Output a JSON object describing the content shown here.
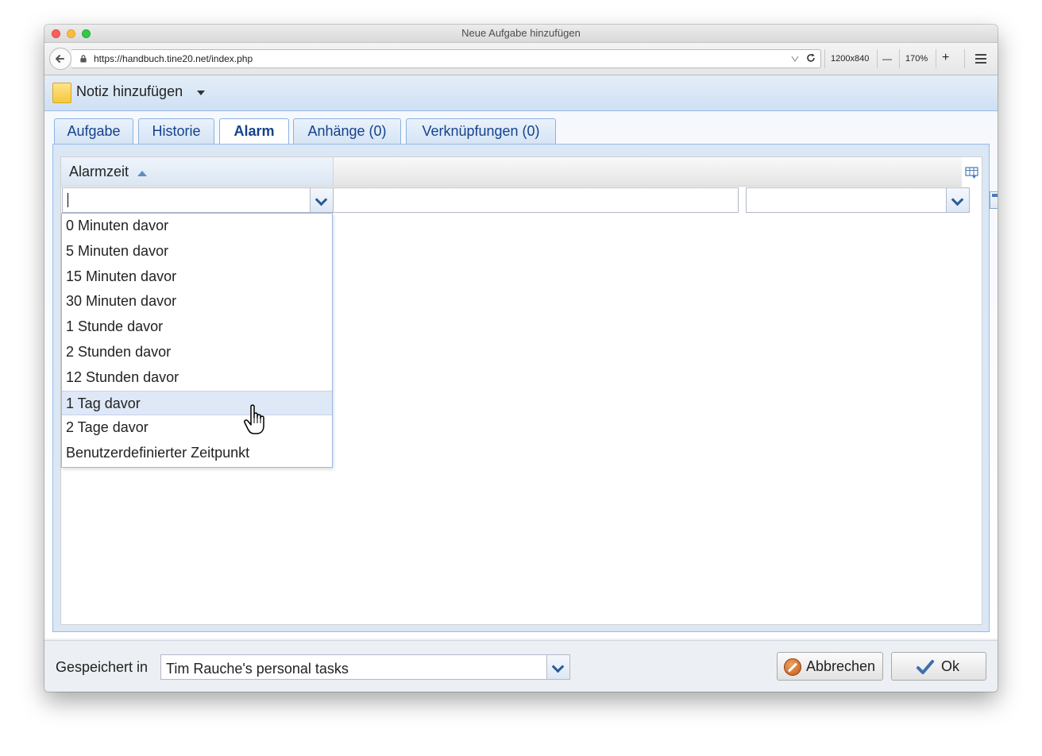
{
  "window": {
    "title": "Neue Aufgabe hinzufügen"
  },
  "browser": {
    "url": "https://handbuch.tine20.net/index.php",
    "viewport": "1200x840",
    "zoom_minus": "—",
    "zoom": "170%",
    "zoom_plus": "+"
  },
  "app": {
    "title": "Notiz hinzufügen"
  },
  "tabs": [
    {
      "label": "Aufgabe"
    },
    {
      "label": "Historie"
    },
    {
      "label": "Alarm"
    },
    {
      "label": "Anhänge (0)"
    },
    {
      "label": "Verknüpfungen (0)"
    }
  ],
  "active_tab": "Alarm",
  "grid": {
    "column_header": "Alarmzeit",
    "sort": "ascending",
    "alarm_input_value": "",
    "date_input_value": "",
    "third_input_value": ""
  },
  "dropdown": {
    "items": [
      {
        "label": "0 Minuten davor"
      },
      {
        "label": "5 Minuten davor"
      },
      {
        "label": "15 Minuten davor"
      },
      {
        "label": "30 Minuten davor"
      },
      {
        "label": "1 Stunde davor"
      },
      {
        "label": "2 Stunden davor"
      },
      {
        "label": "12 Stunden davor"
      },
      {
        "label": "1 Tag davor"
      },
      {
        "label": "2 Tage davor"
      },
      {
        "label": "Benutzerdefinierter Zeitpunkt"
      }
    ],
    "hovered": "1 Tag davor"
  },
  "footer": {
    "saved_in_label": "Gespeichert in",
    "container_value": "Tim Rauche's personal tasks",
    "cancel_label": "Abbrechen",
    "ok_label": "Ok"
  },
  "colors": {
    "accent": "#15428b",
    "border": "#99bbe8",
    "hover_row": "#dfe8f6"
  }
}
